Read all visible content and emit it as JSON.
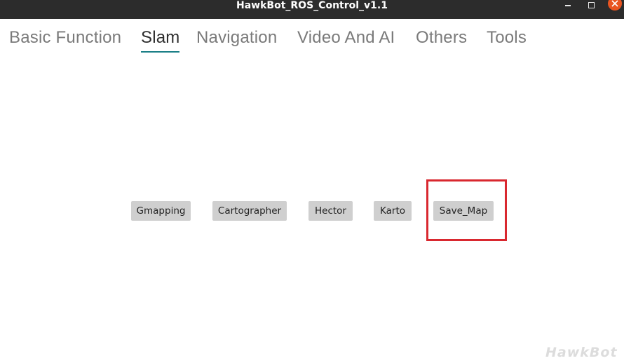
{
  "window": {
    "title": "HawkBot_ROS_Control_v1.1",
    "controls": {
      "minimize_icon": "minimize-icon",
      "maximize_icon": "maximize-icon",
      "close_icon": "close-icon"
    },
    "accent_color": "#1a7f86",
    "close_color": "#e95420"
  },
  "tabs": [
    {
      "label": "Basic Function",
      "active": false
    },
    {
      "label": "Slam",
      "active": true
    },
    {
      "label": "Navigation",
      "active": false
    },
    {
      "label": "Video And AI",
      "active": false
    },
    {
      "label": "Others",
      "active": false
    },
    {
      "label": "Tools",
      "active": false
    }
  ],
  "slam_buttons": [
    {
      "label": "Gmapping"
    },
    {
      "label": "Cartographer"
    },
    {
      "label": "Hector"
    },
    {
      "label": "Karto"
    },
    {
      "label": "Save_Map",
      "highlighted": true
    }
  ],
  "highlight_color": "#d9282f",
  "watermark": "HawkBot"
}
